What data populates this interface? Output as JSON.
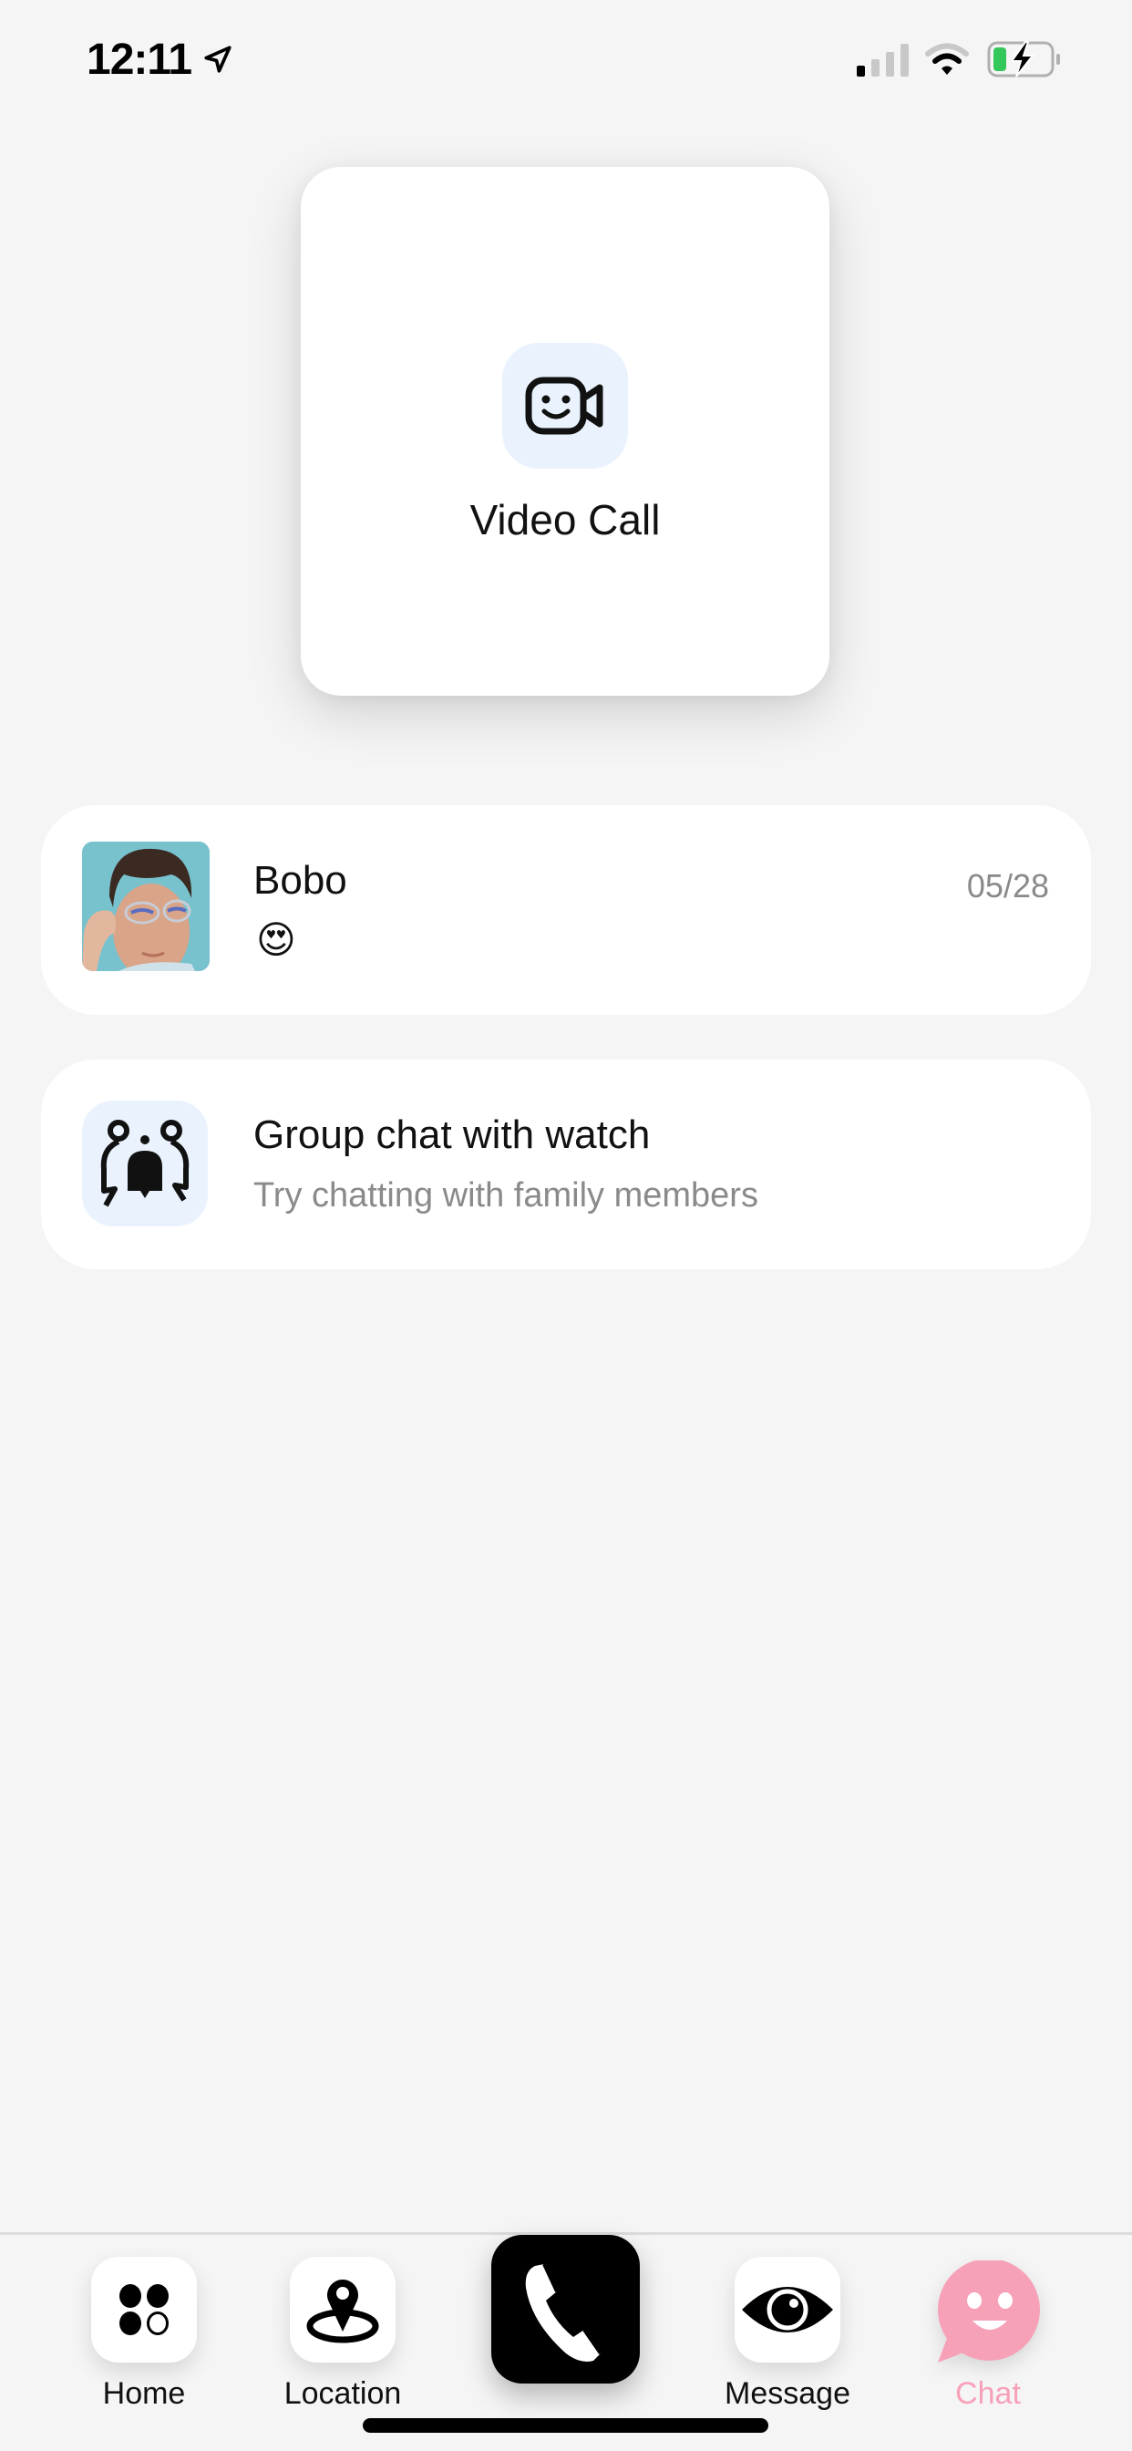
{
  "status_bar": {
    "time": "12:11",
    "location_icon": "location-arrow-icon",
    "signal_icon": "cellular-signal-icon",
    "wifi_icon": "wifi-icon",
    "battery_icon": "battery-charging-icon",
    "battery_color": "#34c759"
  },
  "video_call": {
    "icon": "video-camera-smile-icon",
    "label": "Video Call"
  },
  "chats": [
    {
      "name": "Bobo",
      "date": "05/28",
      "last_message": "😍",
      "avatar": "child-avatar-photo"
    }
  ],
  "group_chat": {
    "icon": "group-chat-icon",
    "title": "Group chat with watch",
    "subtitle": "Try chatting with family members"
  },
  "tabbar": {
    "items": [
      {
        "label": "Home",
        "icon": "home-dots-icon"
      },
      {
        "label": "Location",
        "icon": "location-pin-icon"
      },
      {
        "label": "",
        "icon": "phone-icon"
      },
      {
        "label": "Message",
        "icon": "eye-icon"
      },
      {
        "label": "Chat",
        "icon": "chat-smile-icon",
        "active": true
      }
    ],
    "active_color": "#f7a1b9"
  }
}
